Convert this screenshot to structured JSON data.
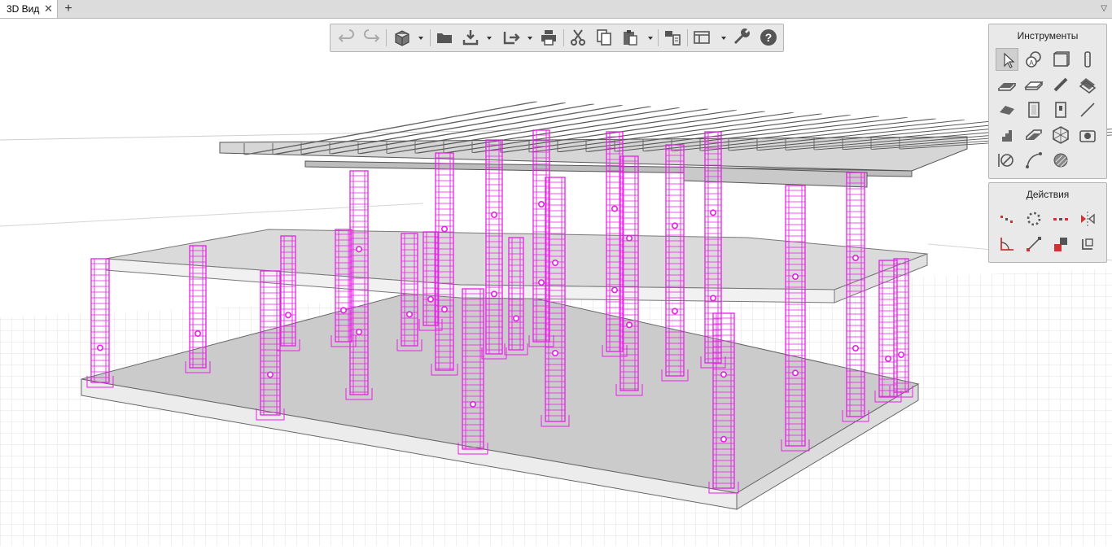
{
  "tabs": [
    {
      "label": "3D Вид",
      "active": true
    }
  ],
  "tab_close_glyph": "✕",
  "tab_add_glyph": "+",
  "tab_menu_glyph": "▽",
  "toolbar": {
    "buttons": [
      "undo",
      "redo",
      "view-cube",
      "open-folder",
      "import",
      "export",
      "print",
      "cut",
      "copy",
      "paste",
      "layers",
      "views",
      "settings",
      "help"
    ]
  },
  "instruments_panel": {
    "title": "Инструменты",
    "tools": [
      "select",
      "annotation",
      "wall",
      "column",
      "slab",
      "beam",
      "rebar",
      "mesh",
      "roof",
      "door",
      "window",
      "line",
      "stairs",
      "ramp",
      "object",
      "camera",
      "dimension",
      "curve",
      "hatch"
    ]
  },
  "actions_panel": {
    "title": "Действия",
    "actions": [
      "move",
      "rotate",
      "copy-array",
      "mirror",
      "angle",
      "stretch",
      "offset",
      "trim"
    ]
  },
  "colors": {
    "rebar": "#e81fe8",
    "slab": "#cfcfcf",
    "grid": "#d9d9d9",
    "beam": "#bdbdbd"
  }
}
